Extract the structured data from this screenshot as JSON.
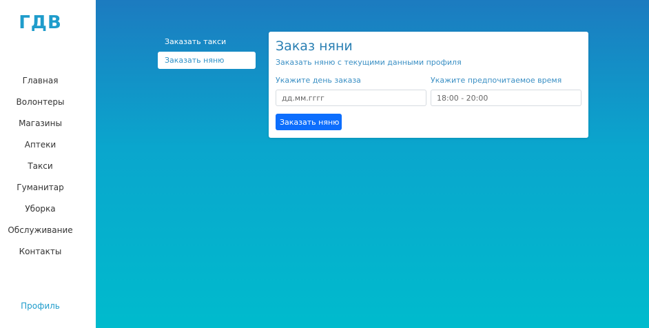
{
  "sidebar": {
    "logo": "ГДВ",
    "items": [
      {
        "label": "Главная"
      },
      {
        "label": "Волонтеры"
      },
      {
        "label": "Магазины"
      },
      {
        "label": "Аптеки"
      },
      {
        "label": "Такси"
      },
      {
        "label": "Гуманитар"
      },
      {
        "label": "Уборка"
      },
      {
        "label": "Обслуживание"
      },
      {
        "label": "Контакты"
      }
    ],
    "profile": "Профиль"
  },
  "submenu": {
    "items": [
      {
        "label": "Заказать такси",
        "active": false
      },
      {
        "label": "Заказать няню",
        "active": true
      }
    ]
  },
  "card": {
    "title": "Заказ няни",
    "subtitle": "Заказать няню с текущими данными профиля",
    "date_label": "Укажите день заказа",
    "date_placeholder": "дд.мм.гггг",
    "time_label": "Укажите предпочитаемое время",
    "time_placeholder": "18:00 - 20:00",
    "submit_label": "Заказать няню"
  },
  "colors": {
    "brand": "#1f9ccb",
    "button": "#0d6efd",
    "gradient_top": "#1c7bc0",
    "gradient_bottom": "#00bbcd"
  }
}
